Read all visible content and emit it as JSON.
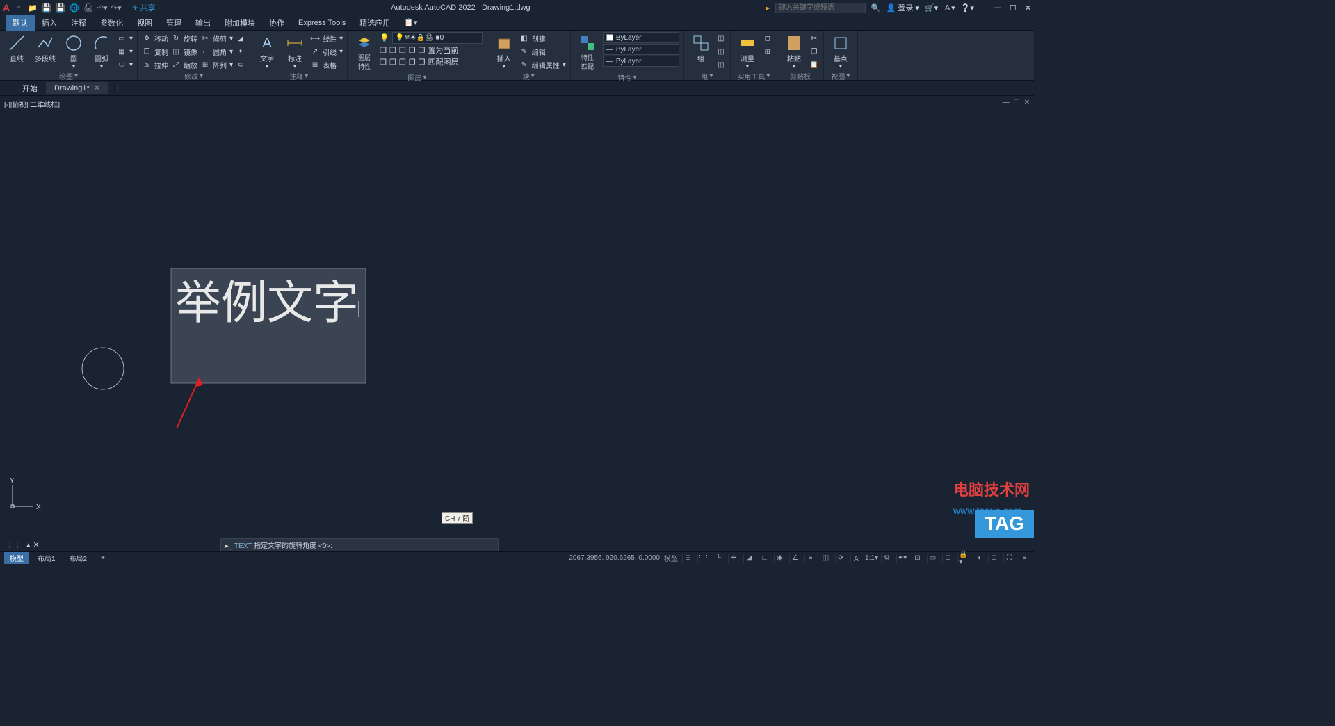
{
  "app": {
    "title_prefix": "Autodesk AutoCAD 2022",
    "filename": "Drawing1.dwg",
    "share": "共享",
    "search_placeholder": "键入关键字或短语",
    "login": "登录"
  },
  "menu": {
    "tabs": [
      "默认",
      "插入",
      "注释",
      "参数化",
      "视图",
      "管理",
      "输出",
      "附加模块",
      "协作",
      "Express Tools",
      "精选应用"
    ],
    "active": 0
  },
  "ribbon": {
    "draw": {
      "title": "绘图",
      "line": "直线",
      "polyline": "多段线",
      "circle": "圆",
      "arc": "圆弧"
    },
    "modify": {
      "title": "修改",
      "move": "移动",
      "rotate": "旋转",
      "trim": "修剪",
      "copy": "复制",
      "mirror": "镜像",
      "fillet": "圆角",
      "stretch": "拉伸",
      "scale": "缩放",
      "array": "阵列"
    },
    "annotation": {
      "title": "注释",
      "text": "文字",
      "dim": "标注",
      "linear": "线性",
      "leader": "引线",
      "table": "表格"
    },
    "layers": {
      "title": "图层",
      "props": "图层特性",
      "current": "0",
      "match": "匹配图层",
      "setcurrent": "置为当前"
    },
    "block": {
      "title": "块",
      "insert": "插入",
      "create": "创建",
      "edit": "编辑",
      "editattr": "编辑属性"
    },
    "properties": {
      "title": "特性",
      "match": "特性匹配",
      "layer": "ByLayer",
      "color": "ByLayer",
      "ltype": "ByLayer"
    },
    "groups": {
      "title": "组",
      "group": "组"
    },
    "utilities": {
      "title": "实用工具",
      "measure": "测量"
    },
    "clipboard": {
      "title": "剪贴板",
      "paste": "粘贴"
    },
    "view": {
      "title": "视图",
      "base": "基点"
    }
  },
  "file_tabs": {
    "start": "开始",
    "items": [
      "Drawing1*"
    ],
    "active": 0
  },
  "viewport": {
    "label": "[-][俯视][二维线框]",
    "text_content": "举例文字",
    "ucs_x": "X",
    "ucs_y": "Y"
  },
  "command": {
    "prefix": "TEXT",
    "prompt": "指定文字的旋转角度 <0>:",
    "ime": "CH ♪ 简"
  },
  "status": {
    "model": "模型",
    "layouts": [
      "布局1",
      "布局2"
    ],
    "coords": "2067.3956, 920.6265, 0.0000",
    "model_space": "模型"
  },
  "watermark": {
    "title": "电脑技术网",
    "url": "www.tagxp.com",
    "badge": "TAG"
  }
}
